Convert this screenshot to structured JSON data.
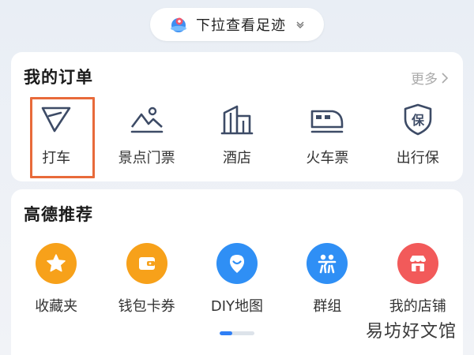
{
  "pull_pill": {
    "text": "下拉查看足迹",
    "icon": "amap-logo-icon",
    "chevron": "chevron-down-icon"
  },
  "orders": {
    "title": "我的订单",
    "more": "更多",
    "items": [
      {
        "label": "打车",
        "icon": "taxi-arrow-icon"
      },
      {
        "label": "景点门票",
        "icon": "scenic-mountain-icon"
      },
      {
        "label": "酒店",
        "icon": "hotel-building-icon"
      },
      {
        "label": "火车票",
        "icon": "train-icon"
      },
      {
        "label": "出行保",
        "icon": "insurance-shield-icon"
      }
    ],
    "highlighted_item": "打车"
  },
  "recommend": {
    "title": "高德推荐",
    "items": [
      {
        "label": "收藏夹",
        "icon": "star-icon",
        "color": "#f7a11a"
      },
      {
        "label": "钱包卡券",
        "icon": "wallet-icon",
        "color": "#f7a11a"
      },
      {
        "label": "DIY地图",
        "icon": "diy-map-icon",
        "color": "#2f8ff5"
      },
      {
        "label": "群组",
        "icon": "group-people-icon",
        "color": "#2f8ff5"
      },
      {
        "label": "我的店铺",
        "icon": "store-icon",
        "color": "#f25a5a"
      }
    ]
  },
  "pager": {
    "active_index": 0,
    "accent": "#2f7ff5"
  },
  "watermark": "易坊好文馆",
  "colors": {
    "icon_stroke": "#3d4b66",
    "highlight_border": "#e86a3a"
  }
}
